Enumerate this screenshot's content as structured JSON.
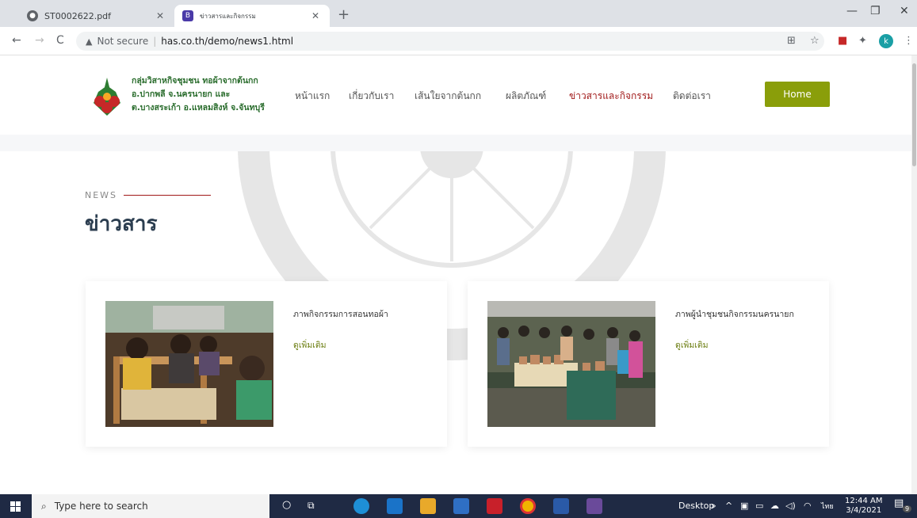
{
  "browser": {
    "tabs": [
      {
        "title": "ST0002622.pdf",
        "active": false
      },
      {
        "title": "ข่าวสารและกิจกรรม",
        "active": true
      }
    ],
    "new_tab": "+",
    "address": {
      "security": "Not secure",
      "url": "has.co.th/demo/news1.html"
    },
    "profile_initial": "k"
  },
  "site": {
    "brand": {
      "line1": "กลุ่มวิสาหกิจชุมชน ทอผ้าจากต้นกก",
      "line2": "อ.ปากพลี จ.นครนายก และ",
      "line3": "ต.บางสระเก้า อ.แหลมสิงห์ จ.จันทบุรี"
    },
    "menu": [
      {
        "label": "หน้าแรก",
        "active": false
      },
      {
        "label": "เกี่ยวกับเรา",
        "active": false
      },
      {
        "label": "เส้นใยจากต้นกก",
        "active": false
      },
      {
        "label": "ผลิตภัณฑ์",
        "active": false
      },
      {
        "label": "ข่าวสารและกิจกรรม",
        "active": true
      },
      {
        "label": "ติดต่อเรา",
        "active": false
      }
    ],
    "home_button": "Home",
    "section": {
      "kicker": "NEWS",
      "title": "ข่าวสาร"
    },
    "cards": [
      {
        "title": "ภาพกิจกรรมการสอนทอผ้า",
        "link": "ดูเพิ่มเติม"
      },
      {
        "title": "ภาพผู้นำชุมชนกิจกรรมนครนายก",
        "link": "ดูเพิ่มเติม"
      }
    ],
    "accent_color": "#a01818",
    "button_color": "#8a9e0a"
  },
  "taskbar": {
    "search_placeholder": "Type here to search",
    "desktop_label": "Desktop",
    "lang": "ไทย",
    "time": "12:44 AM",
    "date": "3/4/2021",
    "notification_count": "9"
  }
}
